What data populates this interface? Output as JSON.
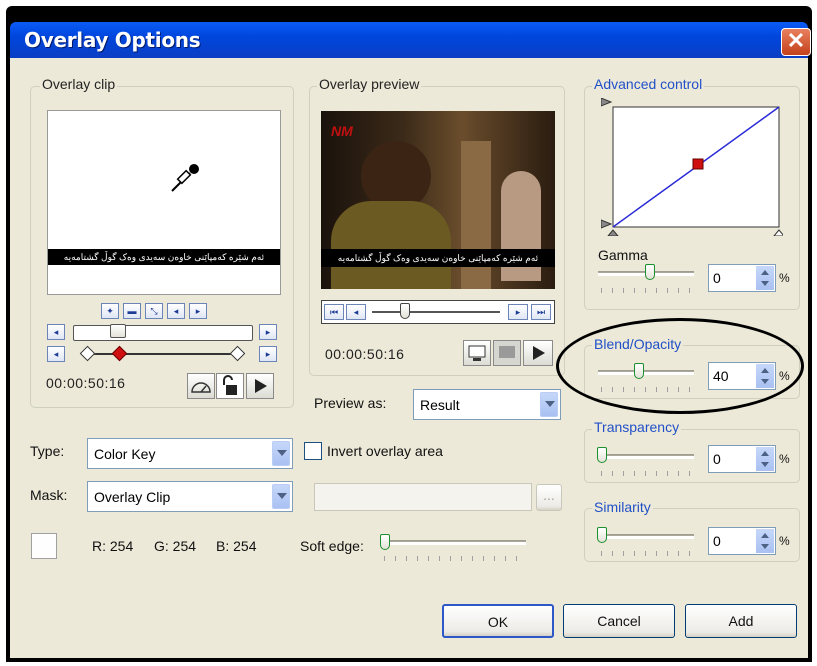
{
  "window": {
    "title": "Overlay Options",
    "close_glyph": "✕"
  },
  "overlay_clip": {
    "label": "Overlay clip",
    "timecode": "00:00:50:16",
    "subtitle_text": "ئەم شێرە کەمپاێنی خاوەن سەیدی وەک گوڵ گشتامەیە",
    "tool_icons": [
      "eyedropper-icon"
    ]
  },
  "overlay_preview": {
    "label": "Overlay preview",
    "timecode": "00:00:50:16",
    "subtitle_text": "ئەم شێرە کەمپاێنی خاوەن سەیدی وەک گوڵ گشتامەیە",
    "logo_text": "NM",
    "preview_as_label": "Preview as:",
    "preview_as_value": "Result"
  },
  "type": {
    "label": "Type:",
    "value": "Color Key"
  },
  "invert": {
    "label": "Invert overlay area",
    "checked": false
  },
  "mask": {
    "label": "Mask:",
    "value": "Overlay Clip",
    "browse": "..."
  },
  "color": {
    "r": "R: 254",
    "g": "G: 254",
    "b": "B: 254",
    "swatch": "#fefefe"
  },
  "soft_edge": {
    "label": "Soft edge:",
    "level": 0
  },
  "advanced": {
    "label": "Advanced control",
    "curve_color": "#2b2bd8",
    "point_color": "#d01010"
  },
  "gamma": {
    "label": "Gamma",
    "value": "0",
    "unit": "%"
  },
  "blend": {
    "label": "Blend/Opacity",
    "value": "40",
    "unit": "%"
  },
  "transparency": {
    "label": "Transparency",
    "value": "0",
    "unit": "%"
  },
  "similarity": {
    "label": "Similarity",
    "value": "0",
    "unit": "%"
  },
  "buttons": {
    "ok": "OK",
    "cancel": "Cancel",
    "add": "Add"
  }
}
